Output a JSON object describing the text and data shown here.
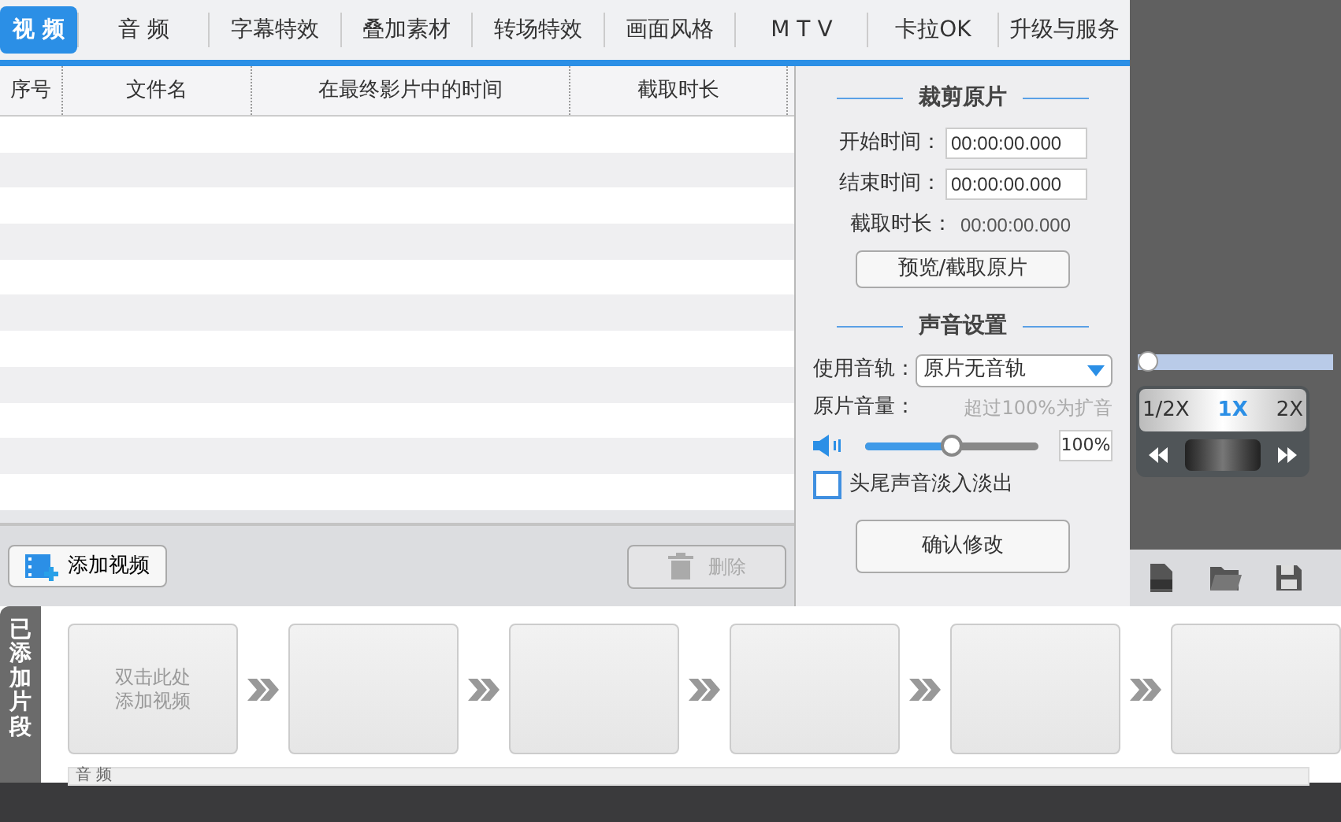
{
  "tabs": [
    {
      "label": "视 频",
      "selected": true
    },
    {
      "label": "音 频",
      "selected": false
    },
    {
      "label": "字幕特效",
      "selected": false
    },
    {
      "label": "叠加素材",
      "selected": false
    },
    {
      "label": "转场特效",
      "selected": false
    },
    {
      "label": "画面风格",
      "selected": false
    },
    {
      "label": "M T V",
      "selected": false
    },
    {
      "label": "卡拉OK",
      "selected": false
    },
    {
      "label": "升级与服务",
      "selected": false
    }
  ],
  "table": {
    "columns": [
      "序号",
      "文件名",
      "在最终影片中的时间",
      "截取时长"
    ]
  },
  "list_toolbar": {
    "add_button": "添加视频",
    "delete_button": {
      "label": "删除",
      "disabled": true
    }
  },
  "trim_panel": {
    "title": "裁剪原片",
    "start_label": "开始时间：",
    "start_value": "00:00:00.000",
    "end_label": "结束时间：",
    "end_value": "00:00:00.000",
    "duration_label": "截取时长：",
    "duration_value": "00:00:00.000",
    "preview_button": "预览/截取原片"
  },
  "sound_panel": {
    "title": "声音设置",
    "track_label": "使用音轨：",
    "track_value": "原片无音轨",
    "volume_label": "原片音量：",
    "volume_hint": "超过100%为扩音",
    "volume": {
      "level": 0.5
    },
    "volume_value": "100%",
    "fade": {
      "label": "头尾声音淡入淡出",
      "checked": false
    },
    "confirm_button": "确认修改"
  },
  "player": {
    "progress": {
      "level": 0
    },
    "speeds": [
      {
        "label": "1/2X",
        "selected": false
      },
      {
        "label": "1X",
        "selected": true
      },
      {
        "label": "2X",
        "selected": false
      }
    ]
  },
  "clips": {
    "tab": "已添加片段",
    "slots": [
      {
        "kind": "hint",
        "lines": [
          "双击此处",
          "添加视频"
        ]
      },
      {
        "kind": "empty"
      },
      {
        "kind": "empty"
      },
      {
        "kind": "empty"
      },
      {
        "kind": "empty"
      },
      {
        "kind": "empty"
      }
    ],
    "audio_label": "音 频"
  }
}
